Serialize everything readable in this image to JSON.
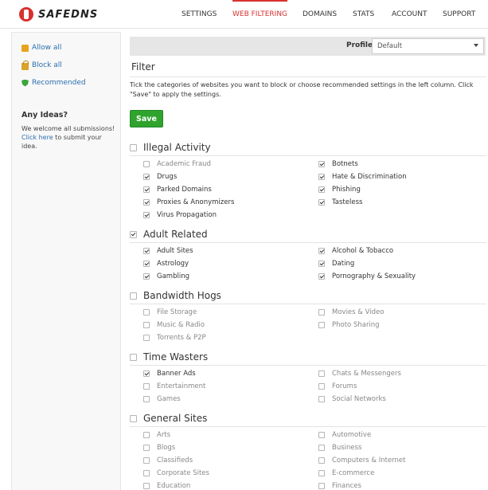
{
  "header": {
    "logo_text": "SAFEDNS",
    "nav": [
      "SETTINGS",
      "WEB FILTERING",
      "DOMAINS",
      "STATS",
      "ACCOUNT",
      "SUPPORT"
    ],
    "active_nav": "WEB FILTERING"
  },
  "sidebar": {
    "items": [
      {
        "label": "Allow all",
        "icon": "thumb-up-icon"
      },
      {
        "label": "Block all",
        "icon": "lock-icon"
      },
      {
        "label": "Recommended",
        "icon": "shield-icon"
      }
    ],
    "ideas_title": "Any Ideas?",
    "ideas_text": "We welcome all submissions!",
    "ideas_link": "Click here",
    "ideas_suffix": " to submit your idea."
  },
  "profile": {
    "label": "Profile",
    "value": "Default"
  },
  "filter": {
    "title": "Filter",
    "description": "Tick the categories of websites you want to block or choose recommended settings in the left column. Click \"Save\" to apply the settings.",
    "save_label": "Save"
  },
  "sections": [
    {
      "name": "Illegal Activity",
      "checked": false,
      "left": [
        {
          "label": "Academic Fraud",
          "checked": false
        },
        {
          "label": "Drugs",
          "checked": true
        },
        {
          "label": "Parked Domains",
          "checked": true
        },
        {
          "label": "Proxies & Anonymizers",
          "checked": true
        },
        {
          "label": "Virus Propagation",
          "checked": true
        }
      ],
      "right": [
        {
          "label": "Botnets",
          "checked": true
        },
        {
          "label": "Hate & Discrimination",
          "checked": true
        },
        {
          "label": "Phishing",
          "checked": true
        },
        {
          "label": "Tasteless",
          "checked": true
        }
      ]
    },
    {
      "name": "Adult Related",
      "checked": true,
      "left": [
        {
          "label": "Adult Sites",
          "checked": true
        },
        {
          "label": "Astrology",
          "checked": true
        },
        {
          "label": "Gambling",
          "checked": true
        }
      ],
      "right": [
        {
          "label": "Alcohol & Tobacco",
          "checked": true
        },
        {
          "label": "Dating",
          "checked": true
        },
        {
          "label": "Pornography & Sexuality",
          "checked": true
        }
      ]
    },
    {
      "name": "Bandwidth Hogs",
      "checked": false,
      "left": [
        {
          "label": "File Storage",
          "checked": false
        },
        {
          "label": "Music & Radio",
          "checked": false
        },
        {
          "label": "Torrents & P2P",
          "checked": false
        }
      ],
      "right": [
        {
          "label": "Movies & Video",
          "checked": false
        },
        {
          "label": "Photo Sharing",
          "checked": false
        }
      ]
    },
    {
      "name": "Time Wasters",
      "checked": false,
      "left": [
        {
          "label": "Banner Ads",
          "checked": true
        },
        {
          "label": "Entertainment",
          "checked": false
        },
        {
          "label": "Games",
          "checked": false
        }
      ],
      "right": [
        {
          "label": "Chats & Messengers",
          "checked": false
        },
        {
          "label": "Forums",
          "checked": false
        },
        {
          "label": "Social Networks",
          "checked": false
        }
      ]
    },
    {
      "name": "General Sites",
      "checked": false,
      "left": [
        {
          "label": "Arts",
          "checked": false
        },
        {
          "label": "Blogs",
          "checked": false
        },
        {
          "label": "Classifieds",
          "checked": false
        },
        {
          "label": "Corporate Sites",
          "checked": false
        },
        {
          "label": "Education",
          "checked": false
        }
      ],
      "right": [
        {
          "label": "Automotive",
          "checked": false
        },
        {
          "label": "Business",
          "checked": false
        },
        {
          "label": "Computers & Internet",
          "checked": false
        },
        {
          "label": "E-commerce",
          "checked": false
        },
        {
          "label": "Finances",
          "checked": false
        }
      ]
    }
  ]
}
